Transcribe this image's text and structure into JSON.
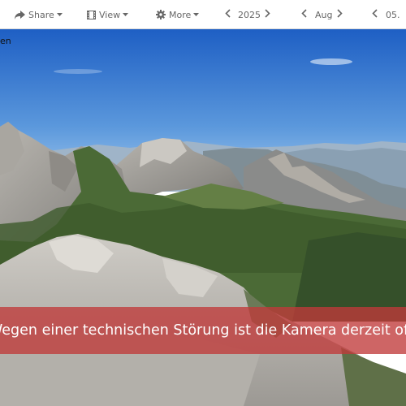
{
  "toolbar": {
    "share_label": "Share",
    "view_label": "View",
    "more_label": "More",
    "year": "2025",
    "month": "Aug",
    "day": "05."
  },
  "icons": {
    "share": "share-arrow-icon",
    "view": "film-strip-icon",
    "more": "gear-icon",
    "prev": "chevron-left-icon",
    "next": "chevron-right-icon",
    "dropdown": "caret-down-icon"
  },
  "camera": {
    "corner_label": "en",
    "status_message": "Wegen einer technischen Störung ist die Kamera derzeit offline"
  },
  "colors": {
    "banner": "#c03a3a",
    "toolbar_text": "#666666",
    "sky_top": "#1e5fc4",
    "sky_bottom": "#9cc6ea"
  }
}
